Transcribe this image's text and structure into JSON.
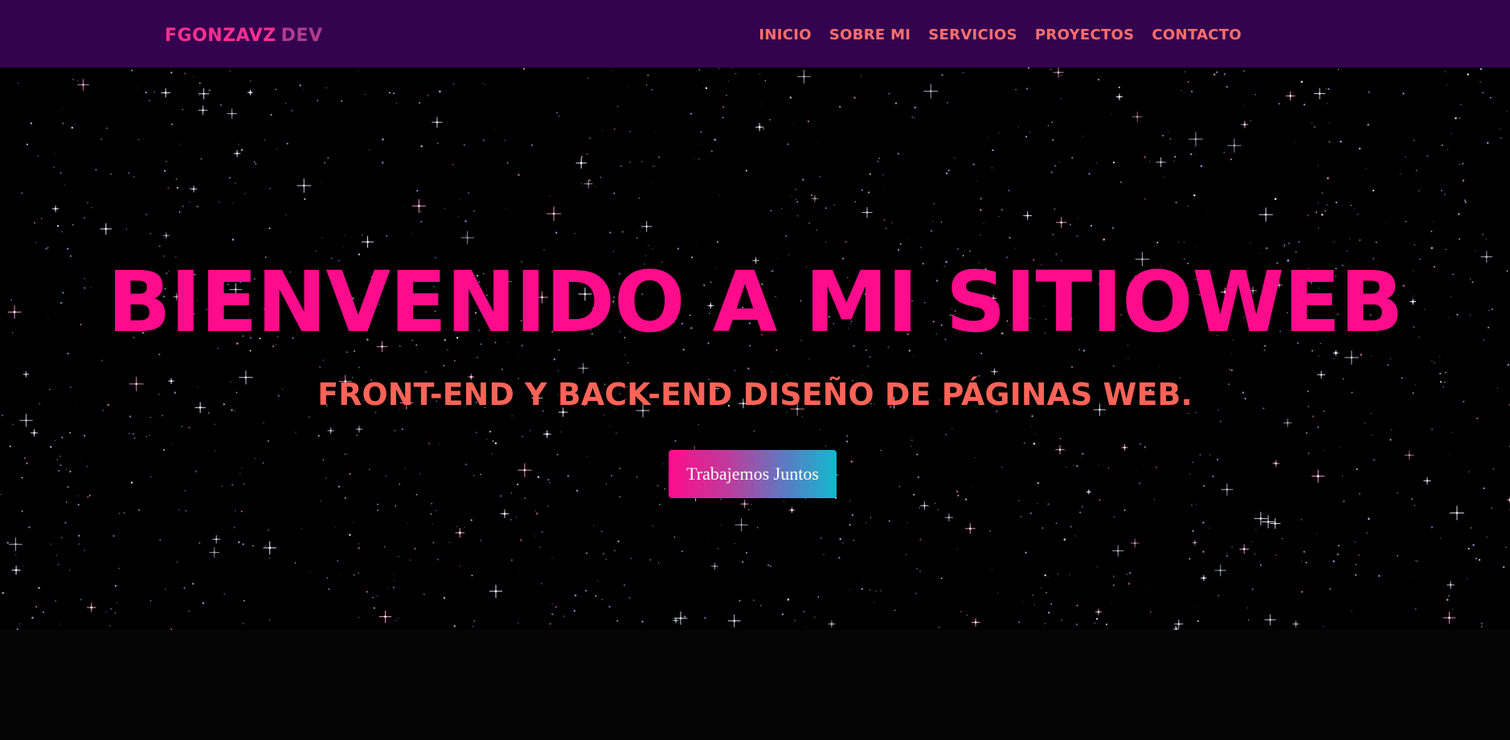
{
  "navbar": {
    "brand_main": "FGONZAVZ",
    "brand_accent": "DEV",
    "links": [
      {
        "label": "INICIO"
      },
      {
        "label": "SOBRE MI"
      },
      {
        "label": "SERVICIOS"
      },
      {
        "label": "PROYECTOS"
      },
      {
        "label": "CONTACTO"
      }
    ]
  },
  "hero": {
    "title": "BIENVENIDO A MI SITIOWEB",
    "subtitle": "FRONT-END Y BACK-END DISEÑO DE PÁGINAS WEB.",
    "cta_label": "Trabajemos Juntos"
  },
  "colors": {
    "navbar_bg": "#34034f",
    "brand_main": "#ff2f8f",
    "brand_accent": "#b13d8d",
    "nav_link": "#ff6f6a",
    "title": "#ff0c8c",
    "subtitle": "#ff6358",
    "cta_gradient_start": "#ff0c8c",
    "cta_gradient_end": "#11b9cd",
    "hero_bg": "#000000"
  }
}
